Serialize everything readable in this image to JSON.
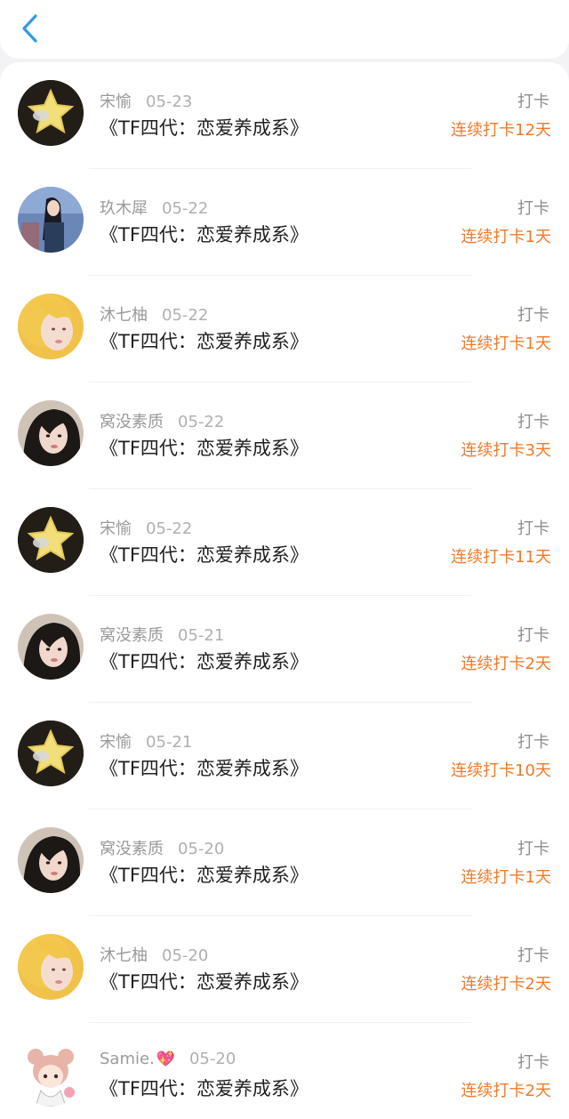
{
  "colors": {
    "accent_blue": "#2f9ae8",
    "streak_orange": "#f07a2a",
    "meta_gray": "#9a9a9a"
  },
  "nav": {
    "back_icon": "chevron-left-icon"
  },
  "items": [
    {
      "user": "宋愉",
      "badge": "",
      "date": "05-23",
      "title": "《TF四代：恋爱养成系》",
      "action": "打卡",
      "streak": "连续打卡12天",
      "avatar": "star"
    },
    {
      "user": "玖木犀",
      "badge": "",
      "date": "05-22",
      "title": "《TF四代：恋爱养成系》",
      "action": "打卡",
      "streak": "连续打卡1天",
      "avatar": "girl-dark"
    },
    {
      "user": "沐七柚",
      "badge": "",
      "date": "05-22",
      "title": "《TF四代：恋爱养成系》",
      "action": "打卡",
      "streak": "连续打卡1天",
      "avatar": "girl-blonde"
    },
    {
      "user": "窝没素质",
      "badge": "",
      "date": "05-22",
      "title": "《TF四代：恋爱养成系》",
      "action": "打卡",
      "streak": "连续打卡3天",
      "avatar": "girl-black"
    },
    {
      "user": "宋愉",
      "badge": "",
      "date": "05-22",
      "title": "《TF四代：恋爱养成系》",
      "action": "打卡",
      "streak": "连续打卡11天",
      "avatar": "star"
    },
    {
      "user": "窝没素质",
      "badge": "",
      "date": "05-21",
      "title": "《TF四代：恋爱养成系》",
      "action": "打卡",
      "streak": "连续打卡2天",
      "avatar": "girl-black"
    },
    {
      "user": "宋愉",
      "badge": "",
      "date": "05-21",
      "title": "《TF四代：恋爱养成系》",
      "action": "打卡",
      "streak": "连续打卡10天",
      "avatar": "star"
    },
    {
      "user": "窝没素质",
      "badge": "",
      "date": "05-20",
      "title": "《TF四代：恋爱养成系》",
      "action": "打卡",
      "streak": "连续打卡1天",
      "avatar": "girl-black"
    },
    {
      "user": "沐七柚",
      "badge": "",
      "date": "05-20",
      "title": "《TF四代：恋爱养成系》",
      "action": "打卡",
      "streak": "连续打卡2天",
      "avatar": "girl-blonde"
    },
    {
      "user": "Samie.",
      "badge": "💖",
      "date": "05-20",
      "title": "《TF四代：恋爱养成系》",
      "action": "打卡",
      "streak": "连续打卡2天",
      "avatar": "anime"
    }
  ]
}
